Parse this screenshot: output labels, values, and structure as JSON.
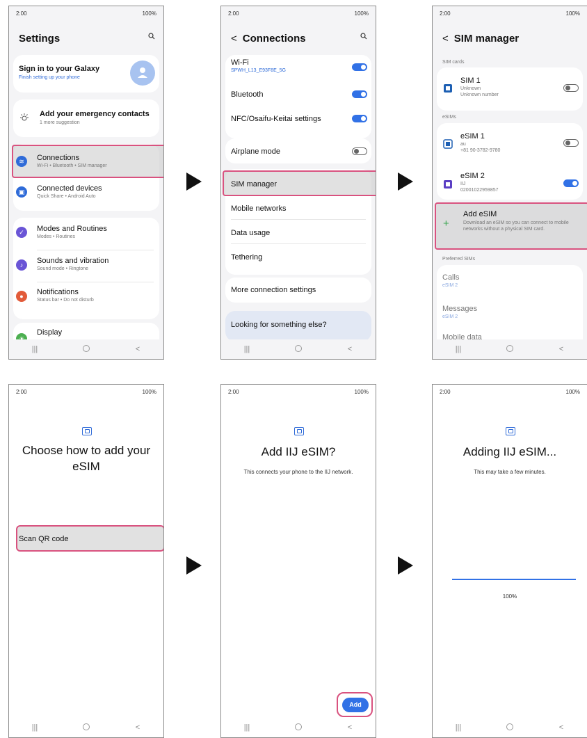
{
  "status": {
    "time": "2:00",
    "battery": "100%"
  },
  "arrows": [
    "next-step",
    "next-step",
    "next-step",
    "next-step"
  ],
  "settings": {
    "title": "Settings",
    "account": {
      "title": "Sign in to your Galaxy",
      "subtitle": "Finish setting up your phone"
    },
    "suggestion": {
      "title": "Add your emergency contacts",
      "subtitle": "1 more suggestion"
    },
    "items": [
      {
        "label": "Connections",
        "sub": "Wi-Fi  •  Bluetooth  •  SIM manager",
        "icon": "wifi-icon",
        "color": "#2f6bd8"
      },
      {
        "label": "Connected devices",
        "sub": "Quick Share  •  Android Auto",
        "icon": "devices-icon",
        "color": "#2f6bd8"
      },
      {
        "label": "Modes and Routines",
        "sub": "Modes  •  Routines",
        "icon": "modes-icon",
        "color": "#6a55d6"
      },
      {
        "label": "Sounds and vibration",
        "sub": "Sound mode  •  Ringtone",
        "icon": "sound-icon",
        "color": "#6a55d6"
      },
      {
        "label": "Notifications",
        "sub": "Status bar  •  Do not disturb",
        "icon": "notification-icon",
        "color": "#e25b3a"
      },
      {
        "label": "Display",
        "sub": "",
        "icon": "display-icon",
        "color": "#4caf50"
      }
    ]
  },
  "connections": {
    "title": "Connections",
    "wifi": {
      "label": "Wi-Fi",
      "network": "SPWH_L13_E93F8E_5G",
      "on": true
    },
    "bluetooth": {
      "label": "Bluetooth",
      "on": true
    },
    "nfc": {
      "label": "NFC/Osaifu-Keitai settings",
      "on": true
    },
    "airplane": {
      "label": "Airplane mode",
      "on": false
    },
    "sim_manager": "SIM manager",
    "mobile_networks": "Mobile networks",
    "data_usage": "Data usage",
    "tethering": "Tethering",
    "more": "More connection settings",
    "looking": "Looking for something else?"
  },
  "sim_manager": {
    "title": "SIM manager",
    "sim_cards_label": "SIM cards",
    "sim1": {
      "name": "SIM 1",
      "line1": "Unknown",
      "line2": "Unknown number",
      "on": false
    },
    "esims_label": "eSIMs",
    "esim1": {
      "name": "eSIM 1",
      "line1": "au",
      "line2": "+81 90-3782-9780",
      "on": false
    },
    "esim2": {
      "name": "eSIM 2",
      "line1": "IIJ",
      "line2": "02001022959857",
      "on": true
    },
    "add": {
      "title": "Add eSIM",
      "desc": "Download an eSIM so you can connect to mobile networks without a physical SIM card."
    },
    "preferred_label": "Preferred SIMs",
    "calls": {
      "label": "Calls",
      "value": "eSIM 2"
    },
    "messages": {
      "label": "Messages",
      "value": "eSIM 2"
    },
    "mobile_data": "Mobile data"
  },
  "choose": {
    "title": "Choose how to add your eSIM",
    "option": "Scan QR code"
  },
  "confirm": {
    "title": "Add IIJ eSIM?",
    "body": "This connects your phone to the IIJ network.",
    "button": "Add"
  },
  "adding": {
    "title": "Adding IIJ eSIM...",
    "body": "This may take a few minutes.",
    "progress_label": "100%",
    "progress": 1.0
  }
}
